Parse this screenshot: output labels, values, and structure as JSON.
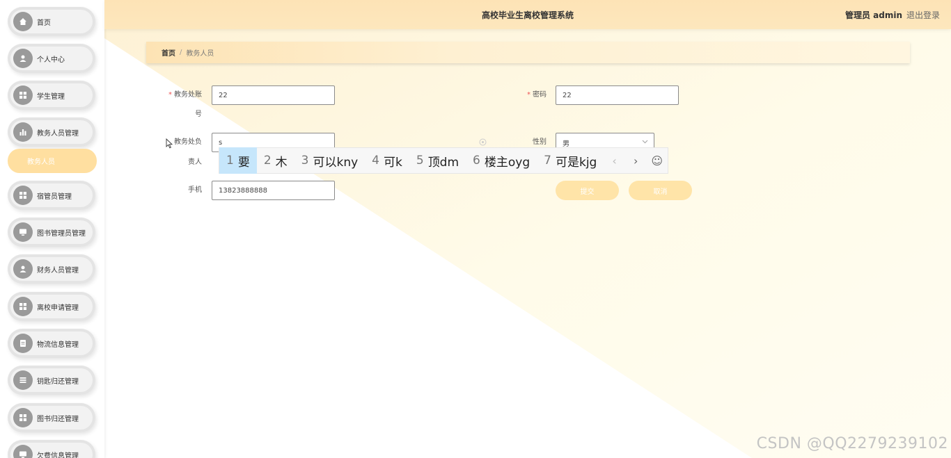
{
  "header": {
    "title": "高校毕业生离校管理系统",
    "user": "管理员 admin",
    "logout": "退出登录"
  },
  "sidebar": {
    "items": [
      {
        "label": "首页",
        "icon": "home-icon"
      },
      {
        "label": "个人中心",
        "icon": "user-icon"
      },
      {
        "label": "学生管理",
        "icon": "grid-icon"
      },
      {
        "label": "教务人员管理",
        "icon": "bar-chart-icon"
      },
      {
        "label": "宿管员管理",
        "icon": "grid-icon"
      },
      {
        "label": "图书管理员管理",
        "icon": "monitor-icon"
      },
      {
        "label": "财务人员管理",
        "icon": "user-icon"
      },
      {
        "label": "离校申请管理",
        "icon": "grid-icon"
      },
      {
        "label": "物流信息管理",
        "icon": "document-icon"
      },
      {
        "label": "钥匙归还管理",
        "icon": "list-icon"
      },
      {
        "label": "图书归还管理",
        "icon": "grid-icon"
      },
      {
        "label": "欠费信息管理",
        "icon": "monitor-icon"
      }
    ],
    "active_sub": "教务人员"
  },
  "breadcrumb": {
    "home": "首页",
    "separator": "/",
    "current": "教务人员"
  },
  "form": {
    "account": {
      "label_line1": "教务处账",
      "label_line2": "号",
      "required": "*",
      "value": "22"
    },
    "password": {
      "label": "密码",
      "required": "*",
      "value": "22"
    },
    "name": {
      "label_line1": "教务处负",
      "label_line2": "责人",
      "value": "s"
    },
    "gender": {
      "label": "性别",
      "value": "男"
    },
    "phone": {
      "label": "手机",
      "value": "13823888888"
    },
    "submit": "提交",
    "cancel": "取消"
  },
  "ime": {
    "candidates": [
      {
        "num": "1",
        "text": "要"
      },
      {
        "num": "2",
        "text": "木"
      },
      {
        "num": "3",
        "text": "可以kny"
      },
      {
        "num": "4",
        "text": "可k"
      },
      {
        "num": "5",
        "text": "顶dm"
      },
      {
        "num": "6",
        "text": "楼主oyg"
      },
      {
        "num": "7",
        "text": "可是kjg"
      }
    ],
    "prev": "‹",
    "next": "›",
    "emoji": "☺"
  },
  "watermark": "CSDN @QQ2279239102"
}
